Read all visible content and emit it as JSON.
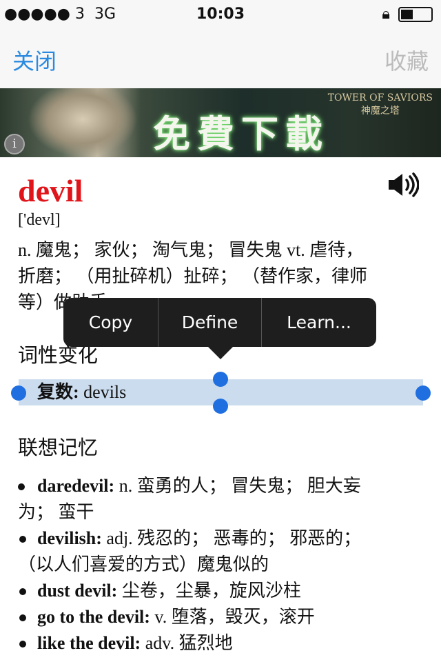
{
  "status_bar": {
    "signal": "●●●●● 3",
    "network": "3G",
    "time": "10:03"
  },
  "nav": {
    "close_label": "关闭",
    "favorite_label": "收藏"
  },
  "banner": {
    "slogan": "免費下載",
    "brand_en": "TOWER OF SAVIORS",
    "brand_zh": "神魔之塔",
    "info_icon": "i"
  },
  "entry": {
    "word": "devil",
    "phonetic": "['devl]",
    "definition_lines": [
      "n. 魔鬼； 家伙； 淘气鬼； 冒失鬼 vt. 虐待，",
      "折磨； （用扯碎机）扯碎； （替作家，律师",
      "等）做助手，"
    ],
    "inflection_heading": "词性变化",
    "inflection_label": "复数:",
    "inflection_value": " devils",
    "association_heading": "联想记忆",
    "associations": [
      {
        "term": "daredevil:",
        "def": " n. 蛮勇的人； 冒失鬼； 胆大妄",
        "cont": "为； 蛮干"
      },
      {
        "term": "devilish:",
        "def": " adj. 残忍的； 恶毒的； 邪恶的；",
        "cont": "（以人们喜爱的方式）魔鬼似的"
      },
      {
        "term": "dust devil:",
        "def": " 尘卷，尘暴，旋风沙柱"
      },
      {
        "term": "go to the devil:",
        "def": " v. 堕落，毁灭，滚开"
      },
      {
        "term": "like the devil:",
        "def": " adv. 猛烈地"
      }
    ]
  },
  "popup": {
    "copy": "Copy",
    "define": "Define",
    "learn": "Learn..."
  },
  "colors": {
    "accent": "#2a8ae0",
    "word": "#e0151b",
    "selection": "#cbdcee",
    "handle": "#1f6fe0"
  }
}
